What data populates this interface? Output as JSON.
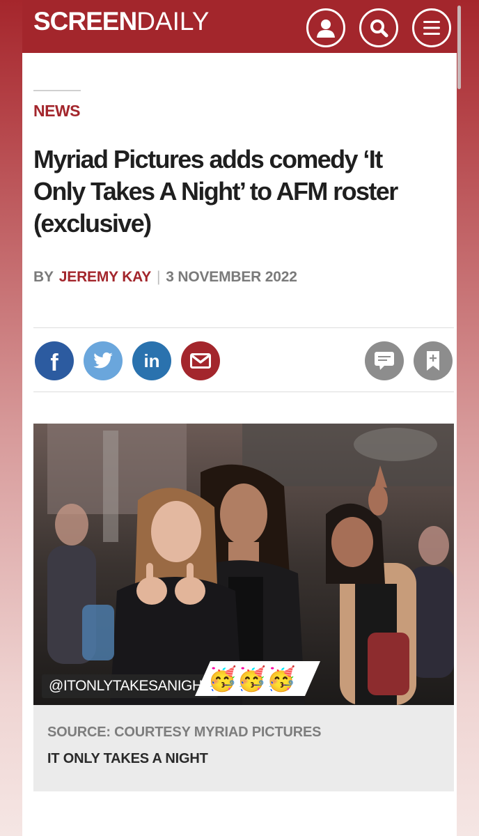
{
  "header": {
    "logo_bold": "SCREEN",
    "logo_light": "DAILY",
    "icons": [
      "user-icon",
      "search-icon",
      "menu-icon"
    ],
    "brand_color": "#a3262c"
  },
  "article": {
    "section": "NEWS",
    "headline_lines": [
      "Myriad Pictures adds comedy ‘It",
      "Only Takes A Night’ to AFM roster",
      "(exclusive)"
    ],
    "byline_prefix": "BY",
    "author": "JEREMY KAY",
    "separator": "|",
    "date": "3 NOVEMBER 2022"
  },
  "share": {
    "facebook_glyph": "f",
    "linkedin_glyph": "in",
    "icons": [
      "facebook-icon",
      "twitter-icon",
      "linkedin-icon",
      "email-icon",
      "comment-icon",
      "bookmark-icon"
    ]
  },
  "image": {
    "instagram_tag": "@ITONLYTAKESANIGHT",
    "emojis": "🥳🥳🥳",
    "caption_source": "SOURCE: COURTESY MYRIAD PICTURES",
    "caption_title": "IT ONLY TAKES A NIGHT"
  }
}
